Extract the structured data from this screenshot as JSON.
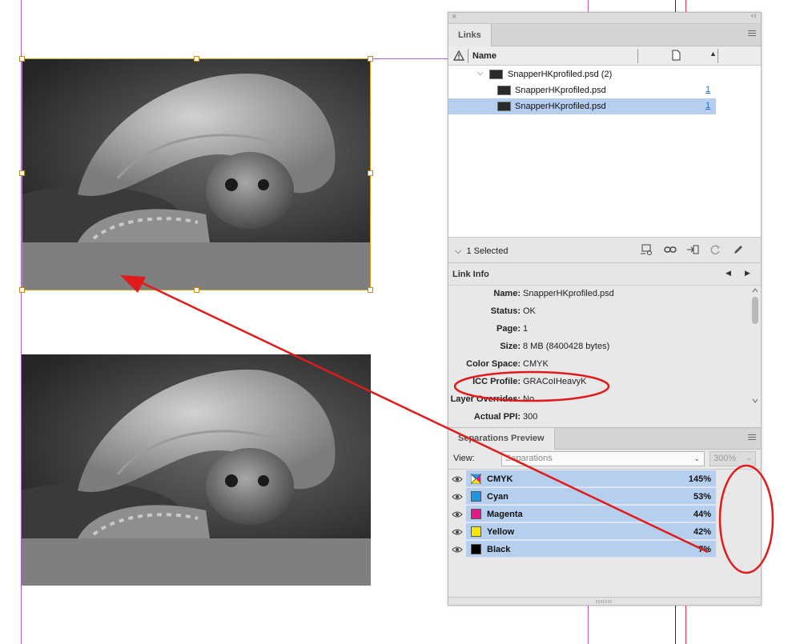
{
  "links_panel": {
    "tab_label": "Links",
    "column_name": "Name",
    "items": [
      {
        "name": "SnapperHKprofiled.psd (2)",
        "page": ""
      },
      {
        "name": "SnapperHKprofiled.psd",
        "page": "1"
      },
      {
        "name": "SnapperHKprofiled.psd",
        "page": "1"
      }
    ],
    "selection_label": "1 Selected"
  },
  "link_info": {
    "title": "Link Info",
    "rows": [
      {
        "key": "Name:",
        "value": "SnapperHKprofiled.psd"
      },
      {
        "key": "Status:",
        "value": "OK"
      },
      {
        "key": "Page:",
        "value": "1"
      },
      {
        "key": "Size:",
        "value": "8 MB (8400428 bytes)"
      },
      {
        "key": "Color Space:",
        "value": "CMYK"
      },
      {
        "key": "ICC Profile:",
        "value": "GRACoIHeavyK"
      },
      {
        "key": "Layer Overrides:",
        "value": "No"
      },
      {
        "key": "Actual PPI:",
        "value": "300"
      }
    ]
  },
  "separations": {
    "tab_label": "Separations Preview",
    "view_label": "View:",
    "view_value": "Separations",
    "zoom_value": "300%",
    "inks": [
      {
        "name": "CMYK",
        "percent": "145%"
      },
      {
        "name": "Cyan",
        "percent": "53%"
      },
      {
        "name": "Magenta",
        "percent": "44%"
      },
      {
        "name": "Yellow",
        "percent": "42%"
      },
      {
        "name": "Black",
        "percent": "7%"
      }
    ]
  },
  "colors": {
    "selection_blue": "#b7cfee",
    "frame_gold": "#d79a1c",
    "guide_magenta": "#b45ad0",
    "annotation_red": "#e11a1a",
    "cyan": "#1e96e6",
    "magenta": "#e6168c",
    "yellow": "#f5e600",
    "black": "#000000"
  }
}
